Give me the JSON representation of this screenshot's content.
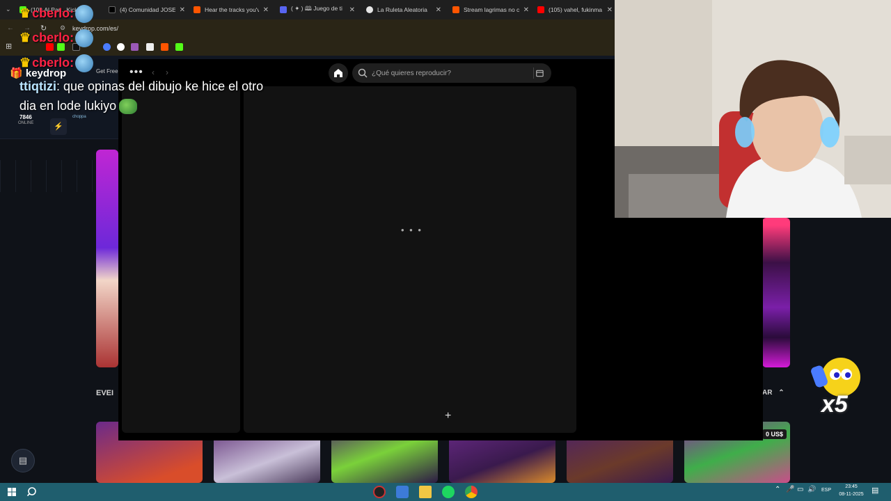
{
  "browser": {
    "tabs": [
      {
        "label": "(10!) Al Pan...Kick",
        "icon": "kick-icon",
        "color": "#53fc18"
      },
      {
        "label": "(4) Comunidad JOSE",
        "icon": "x-icon",
        "color": "#ffffff"
      },
      {
        "label": "Hear the tracks you've",
        "icon": "soundcloud-icon",
        "color": "#ff5500"
      },
      {
        "label": "( ✦ ) 🕮 Juego de ti",
        "icon": "discord-icon",
        "color": "#5865f2"
      },
      {
        "label": "La Ruleta Aleatoria",
        "icon": "wheel-icon",
        "color": "#e5e5e5"
      },
      {
        "label": "Stream lagrimas no c",
        "icon": "soundcloud-icon",
        "color": "#ff5500"
      },
      {
        "label": "(105) vahel, fukinma",
        "icon": "youtube-icon",
        "color": "#ff0000"
      }
    ],
    "url": "keydrop.com/es/",
    "bookmark_colors": [
      "#53fc18",
      "#ff0000",
      "#53fc18",
      "#000000",
      "#4a7cff",
      "#ffffff",
      "#9b59b6",
      "#ffffff",
      "#ff5500",
      "#53fc18"
    ]
  },
  "site": {
    "logo": "keydrop",
    "online_count": "7846",
    "online_label": "ONLINE",
    "get_free": "Get Free",
    "choppa": "choppa",
    "events_label": "EVEI",
    "sort_label": "AR",
    "price_tag": "0 US$",
    "multiplier": "x5",
    "card_colors": [
      "#7a2b8c",
      "#5b2a73",
      "#4a1f6b",
      "#6b2a8a",
      "#3a1a4d",
      "#8a2b9c"
    ]
  },
  "spotify": {
    "more_icon": "•••",
    "search_placeholder": "¿Qué quieres reproducir?",
    "loader": "• • •",
    "plus": "+"
  },
  "chat": {
    "lines": [
      {
        "user": "cberlo",
        "suffix": ":"
      },
      {
        "user": "cberlo",
        "suffix": ":"
      },
      {
        "user": "cberlo",
        "suffix": ":"
      }
    ],
    "message_user": "ttiqtizi",
    "message_line1": ": que opinas del dibujo ke hice el otro",
    "message_line2": "dia en lode lukiyo"
  },
  "taskbar": {
    "lang": "ESP",
    "time": "23:45",
    "date": "08-11-2025"
  }
}
